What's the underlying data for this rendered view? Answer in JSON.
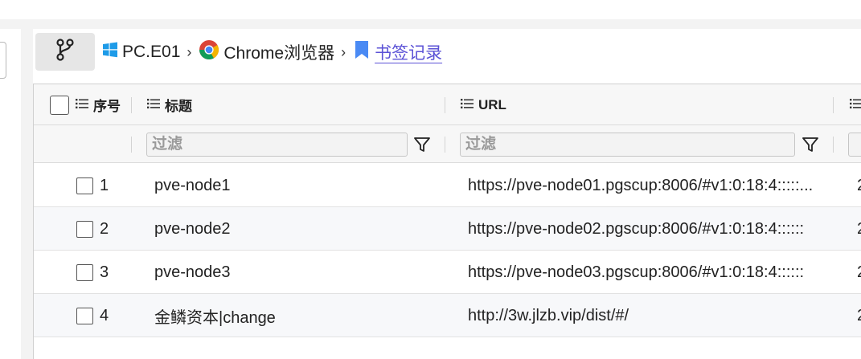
{
  "breadcrumb": {
    "items": [
      {
        "label": "PC.E01",
        "icon": "windows-icon"
      },
      {
        "label": "Chrome浏览器",
        "icon": "chrome-icon"
      },
      {
        "label": "书签记录",
        "icon": "bookmark-icon"
      }
    ],
    "separator": "›"
  },
  "table": {
    "columns": [
      {
        "label": "序号"
      },
      {
        "label": "标题"
      },
      {
        "label": "URL"
      }
    ],
    "filter_placeholder": "过滤",
    "rows": [
      {
        "index": "1",
        "title": "pve-node1",
        "url": "https://pve-node01.pgscup:8006/#v1:0:18:4:::::..."
      },
      {
        "index": "2",
        "title": "pve-node2",
        "url": "https://pve-node02.pgscup:8006/#v1:0:18:4::::::"
      },
      {
        "index": "3",
        "title": "pve-node3",
        "url": "https://pve-node03.pgscup:8006/#v1:0:18:4::::::"
      },
      {
        "index": "4",
        "title": "金鳞资本|change",
        "url": "http://3w.jlzb.vip/dist/#/"
      }
    ],
    "partial_column_values": [
      "2",
      "2",
      "2",
      "2"
    ]
  },
  "colors": {
    "link": "#5b52d6",
    "bookmark": "#4a8af4"
  }
}
